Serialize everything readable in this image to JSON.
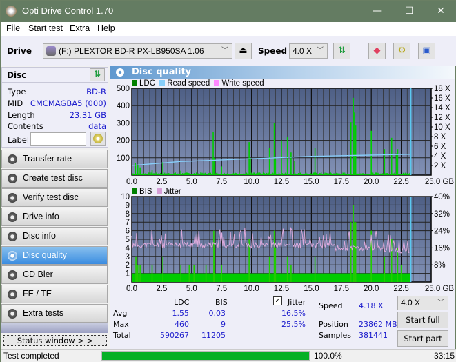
{
  "window": {
    "title": "Opti Drive Control 1.70",
    "minimize": "—",
    "maximize": "☐",
    "close": "✕"
  },
  "menu": [
    {
      "label": "File"
    },
    {
      "label": "Start test"
    },
    {
      "label": "Extra"
    },
    {
      "label": "Help"
    }
  ],
  "toolbar": {
    "drive_label": "Drive",
    "drive_value": "(F:)  PLEXTOR BD-R  PX-LB950SA 1.06",
    "speed_label": "Speed",
    "speed_value": "4.0 X",
    "eject_icon": "⏏"
  },
  "disc": {
    "header": "Disc",
    "rows": [
      {
        "key": "Type",
        "value": "BD-R"
      },
      {
        "key": "MID",
        "value": "CMCMAGBA5 (000)"
      },
      {
        "key": "Length",
        "value": "23.31 GB"
      },
      {
        "key": "Contents",
        "value": "data"
      }
    ],
    "label_key": "Label",
    "label_value": ""
  },
  "nav": [
    {
      "label": "Transfer rate",
      "active": false
    },
    {
      "label": "Create test disc",
      "active": false
    },
    {
      "label": "Verify test disc",
      "active": false
    },
    {
      "label": "Drive info",
      "active": false
    },
    {
      "label": "Disc info",
      "active": false
    },
    {
      "label": "Disc quality",
      "active": true
    },
    {
      "label": "CD Bler",
      "active": false
    },
    {
      "label": "FE / TE",
      "active": false
    },
    {
      "label": "Extra tests",
      "active": false
    }
  ],
  "status_window_button": "Status window > >",
  "panel_title": "Disc quality",
  "chart_data": [
    {
      "type": "bar",
      "title": "LDC",
      "legend": [
        "LDC",
        "Read speed",
        "Write speed"
      ],
      "legend_colors": [
        "#008000",
        "#87cefa",
        "#ff88ff"
      ],
      "xlabel": "GB",
      "xlim": [
        0,
        25
      ],
      "x_ticks": [
        "0.0",
        "2.5",
        "5.0",
        "7.5",
        "10.0",
        "12.5",
        "15.0",
        "17.5",
        "20.0",
        "22.5",
        "25.0 GB"
      ],
      "ylim": [
        0,
        500
      ],
      "y_ticks": [
        "500",
        "400",
        "300",
        "200",
        "100"
      ],
      "y2lim": [
        0,
        18
      ],
      "y2_ticks": [
        "18 X",
        "16 X",
        "14 X",
        "12 X",
        "10 X",
        "8 X",
        "6 X",
        "4 X",
        "2 X"
      ],
      "end_marker_gb": 23.31,
      "ldc_spikes": [
        [
          0.3,
          70
        ],
        [
          0.5,
          60
        ],
        [
          0.7,
          45
        ],
        [
          1.7,
          30
        ],
        [
          2.6,
          75
        ],
        [
          4.1,
          25
        ],
        [
          6.8,
          250
        ],
        [
          6.9,
          100
        ],
        [
          7.5,
          50
        ],
        [
          9.8,
          190
        ],
        [
          9.9,
          100
        ],
        [
          11.5,
          155
        ],
        [
          11.9,
          300
        ],
        [
          12.0,
          90
        ],
        [
          12.5,
          200
        ],
        [
          13.0,
          220
        ],
        [
          13.3,
          130
        ],
        [
          13.6,
          80
        ],
        [
          15.3,
          155
        ],
        [
          18.3,
          305
        ],
        [
          18.5,
          445
        ],
        [
          18.6,
          360
        ],
        [
          18.7,
          285
        ],
        [
          20.0,
          255
        ],
        [
          21.1,
          150
        ],
        [
          21.7,
          215
        ],
        [
          22.1,
          125
        ],
        [
          22.2,
          150
        ],
        [
          23.3,
          50
        ]
      ],
      "read_speed_x": [
        [
          0,
          2.0
        ],
        [
          1,
          2.2
        ],
        [
          2,
          2.4
        ],
        [
          3,
          2.6
        ],
        [
          4,
          2.8
        ],
        [
          5,
          2.9
        ],
        [
          6,
          3.0
        ],
        [
          7,
          3.1
        ],
        [
          8,
          3.2
        ],
        [
          9,
          3.3
        ],
        [
          10,
          3.4
        ],
        [
          11,
          3.5
        ],
        [
          12,
          3.6
        ],
        [
          13,
          3.7
        ],
        [
          14,
          3.8
        ],
        [
          15,
          3.9
        ],
        [
          16,
          3.95
        ],
        [
          17,
          4.0
        ],
        [
          18,
          4.05
        ],
        [
          19,
          4.1
        ],
        [
          20,
          4.15
        ],
        [
          21,
          4.2
        ],
        [
          22,
          4.25
        ],
        [
          23.3,
          4.3
        ]
      ]
    },
    {
      "type": "bar",
      "title": "BIS",
      "legend": [
        "BIS",
        "Jitter"
      ],
      "legend_colors": [
        "#008000",
        "#d8a0d8"
      ],
      "xlabel": "GB",
      "xlim": [
        0,
        25
      ],
      "x_ticks": [
        "0.0",
        "2.5",
        "5.0",
        "7.5",
        "10.0",
        "12.5",
        "15.0",
        "17.5",
        "20.0",
        "22.5",
        "25.0 GB"
      ],
      "ylim": [
        0,
        10
      ],
      "y_ticks": [
        "10",
        "9",
        "8",
        "7",
        "6",
        "5",
        "4",
        "3",
        "2",
        "1"
      ],
      "y2lim": [
        0,
        40
      ],
      "y2_ticks": [
        "40%",
        "32%",
        "24%",
        "16%",
        "8%"
      ],
      "end_marker_gb": 23.31,
      "bis_base": 1,
      "bis_spikes": [
        [
          0.35,
          3
        ],
        [
          0.5,
          2
        ],
        [
          0.7,
          2
        ],
        [
          1.7,
          2
        ],
        [
          2.6,
          3
        ],
        [
          4.1,
          2
        ],
        [
          4.8,
          2
        ],
        [
          5.2,
          2
        ],
        [
          6.2,
          2
        ],
        [
          6.85,
          6
        ],
        [
          6.9,
          4
        ],
        [
          7.5,
          2
        ],
        [
          9.8,
          5
        ],
        [
          11.5,
          3
        ],
        [
          11.9,
          6
        ],
        [
          12.0,
          4
        ],
        [
          13.0,
          3
        ],
        [
          13.3,
          2
        ],
        [
          15.3,
          3
        ],
        [
          18.3,
          7
        ],
        [
          18.5,
          9
        ],
        [
          18.6,
          7
        ],
        [
          18.7,
          7
        ],
        [
          20.0,
          6
        ],
        [
          21.1,
          3
        ],
        [
          21.7,
          5
        ],
        [
          22.2,
          4
        ],
        [
          22.5,
          2
        ]
      ],
      "jitter_percent_range": [
        14,
        25.5
      ]
    }
  ],
  "stats": {
    "col_ldc": "LDC",
    "col_bis": "BIS",
    "jitter_checkbox_label": "Jitter",
    "jitter_checked": true,
    "rows": [
      {
        "label": "Avg",
        "ldc": "1.55",
        "bis": "0.03",
        "jitter": "16.5%"
      },
      {
        "label": "Max",
        "ldc": "460",
        "bis": "9",
        "jitter": "25.5%"
      },
      {
        "label": "Total",
        "ldc": "590267",
        "bis": "11205",
        "jitter": ""
      }
    ],
    "speed_label": "Speed",
    "speed_value": "4.18 X",
    "position_label": "Position",
    "position_value": "23862 MB",
    "samples_label": "Samples",
    "samples_value": "381441",
    "speed_select": "4.0 X",
    "start_full": "Start full",
    "start_part": "Start part"
  },
  "statusbar": {
    "text": "Test completed",
    "progress_percent": 100,
    "progress_label": "100.0%",
    "time": "33:15"
  }
}
